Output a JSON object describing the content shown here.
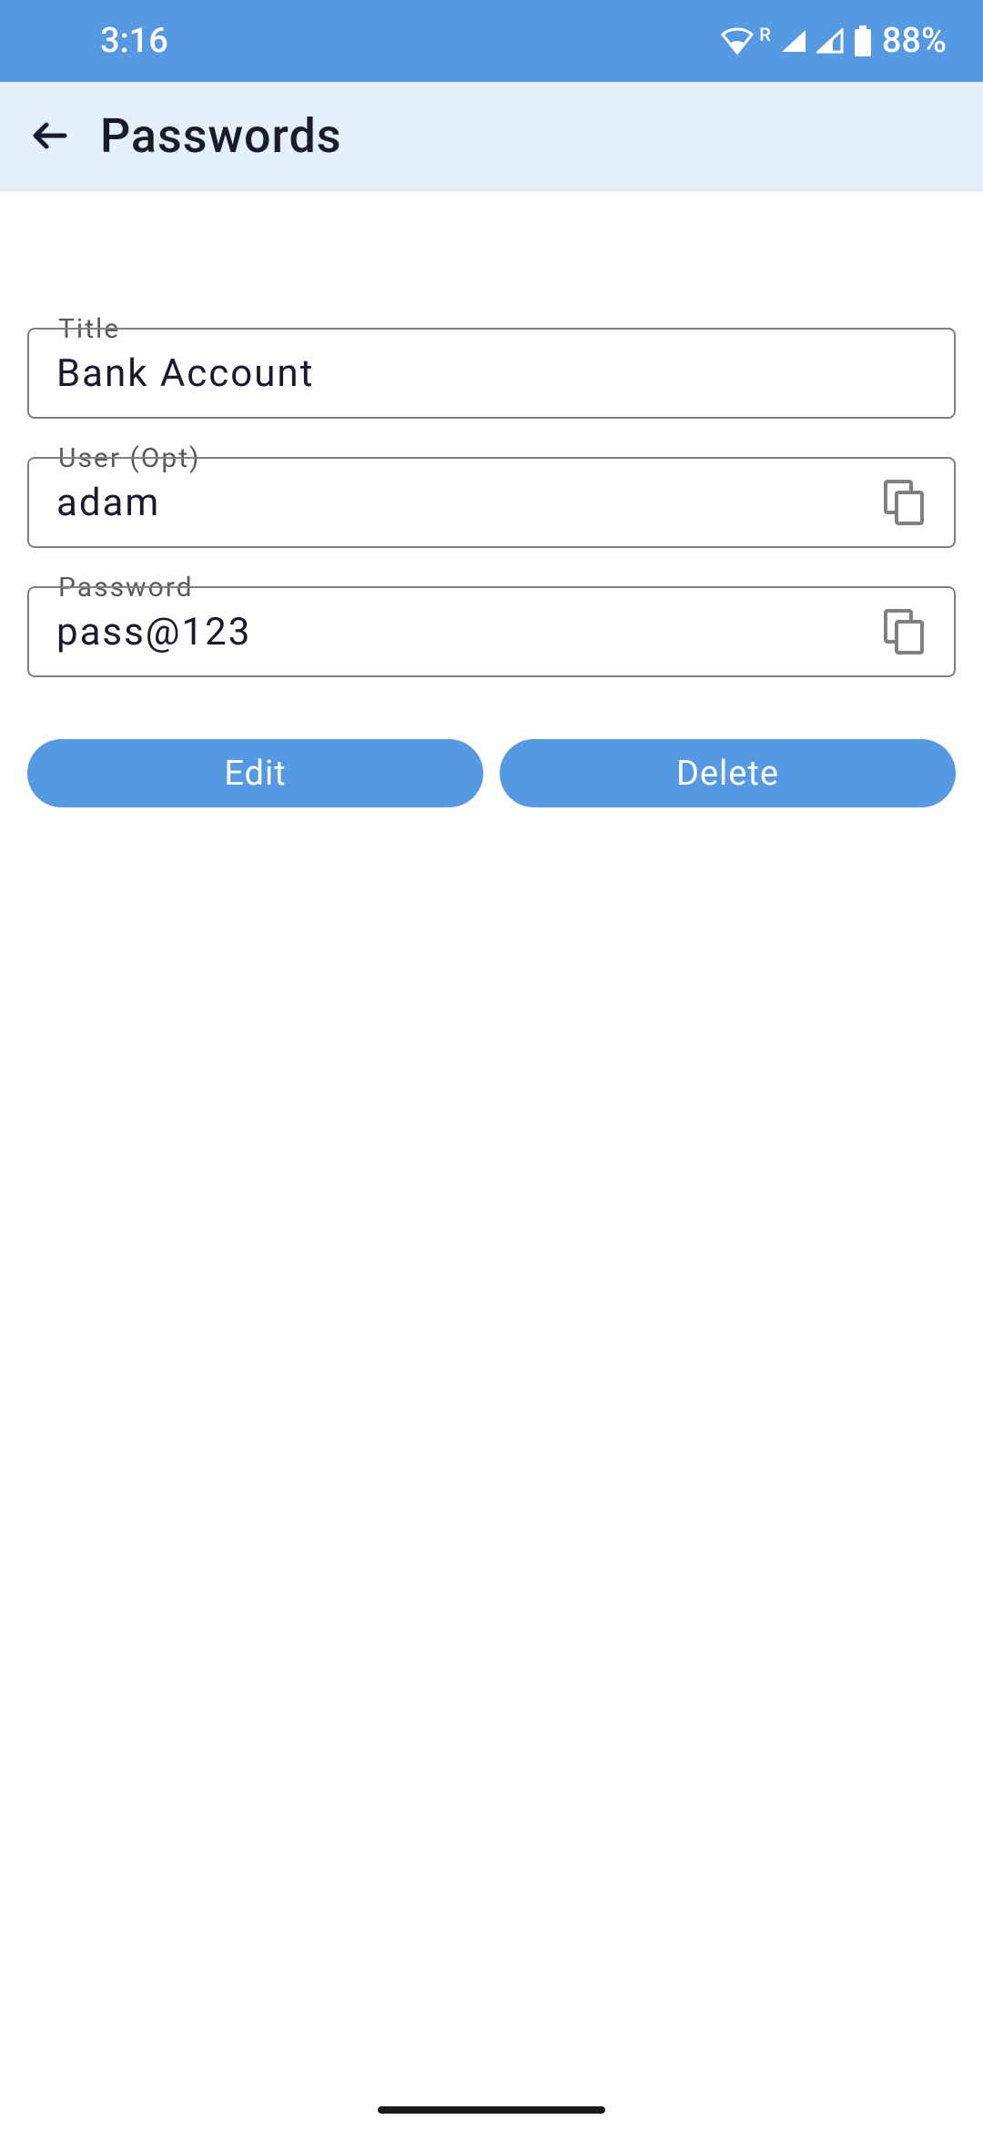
{
  "statusbar": {
    "time": "3:16",
    "battery": "88%",
    "wifi_indicator": "R"
  },
  "appbar": {
    "title": "Passwords"
  },
  "fields": {
    "title": {
      "label": "Title",
      "value": "Bank Account"
    },
    "user": {
      "label": "User (Opt)",
      "value": "adam"
    },
    "password": {
      "label": "Password",
      "value": "pass@123"
    }
  },
  "buttons": {
    "edit": "Edit",
    "delete": "Delete"
  }
}
